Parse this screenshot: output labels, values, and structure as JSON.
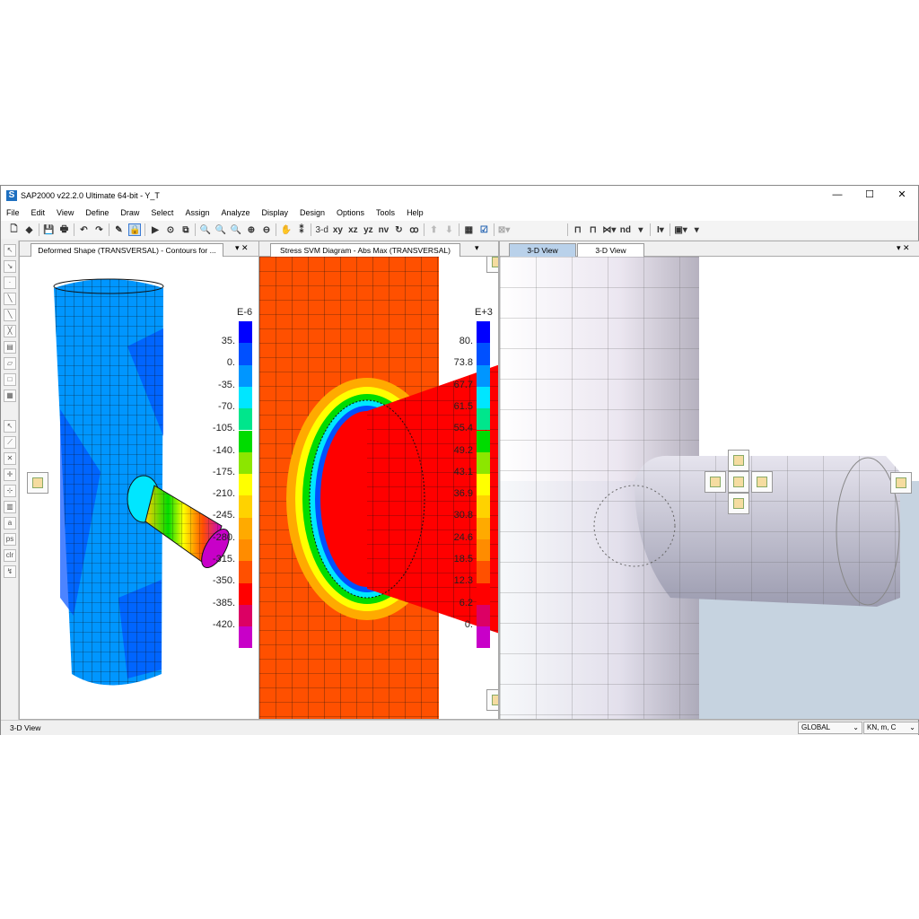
{
  "window": {
    "title": "SAP2000 v22.2.0 Ultimate 64-bit - Y_T",
    "logo": "S",
    "minimize": "—",
    "maximize": "☐",
    "close": "✕"
  },
  "menu": [
    "File",
    "Edit",
    "View",
    "Define",
    "Draw",
    "Select",
    "Assign",
    "Analyze",
    "Display",
    "Design",
    "Options",
    "Tools",
    "Help"
  ],
  "toolbar": {
    "view_3d": "3-d",
    "view_xy": "xy",
    "view_xz": "xz",
    "view_yz": "yz",
    "view_nv": "nv",
    "nd": "nd"
  },
  "panels": [
    {
      "tab": "Deformed Shape (TRANSVERSAL) - Contours for ...",
      "controls": "▾ ✕",
      "legend": {
        "unit": "E-6",
        "labels": [
          "35.",
          "0.",
          "-35.",
          "-70.",
          "-105.",
          "-140.",
          "-175.",
          "-210.",
          "-245.",
          "-280.",
          "-315.",
          "-350.",
          "-385.",
          "-420."
        ]
      }
    },
    {
      "tab": "Stress SVM Diagram - Abs Max  (TRANSVERSAL)",
      "controls": "▾",
      "legend": {
        "unit": "E+3",
        "labels": [
          "80.",
          "73.8",
          "67.7",
          "61.5",
          "55.4",
          "49.2",
          "43.1",
          "36.9",
          "30.8",
          "24.6",
          "18.5",
          "12.3",
          "6.2",
          "0."
        ]
      }
    },
    {
      "tabs": [
        "3-D View",
        "3-D View"
      ],
      "controls": "▾ ✕"
    }
  ],
  "legend_colors": [
    "#0000ff",
    "#0050ff",
    "#0096ff",
    "#00e6ff",
    "#00e68c",
    "#00dc00",
    "#8ce600",
    "#ffff00",
    "#ffd200",
    "#ffaa00",
    "#ff8c00",
    "#ff5000",
    "#ff0000",
    "#dc0064",
    "#c800c8"
  ],
  "status": {
    "text": "3-D View",
    "coord_system": "GLOBAL",
    "units": "KN, m, C"
  }
}
